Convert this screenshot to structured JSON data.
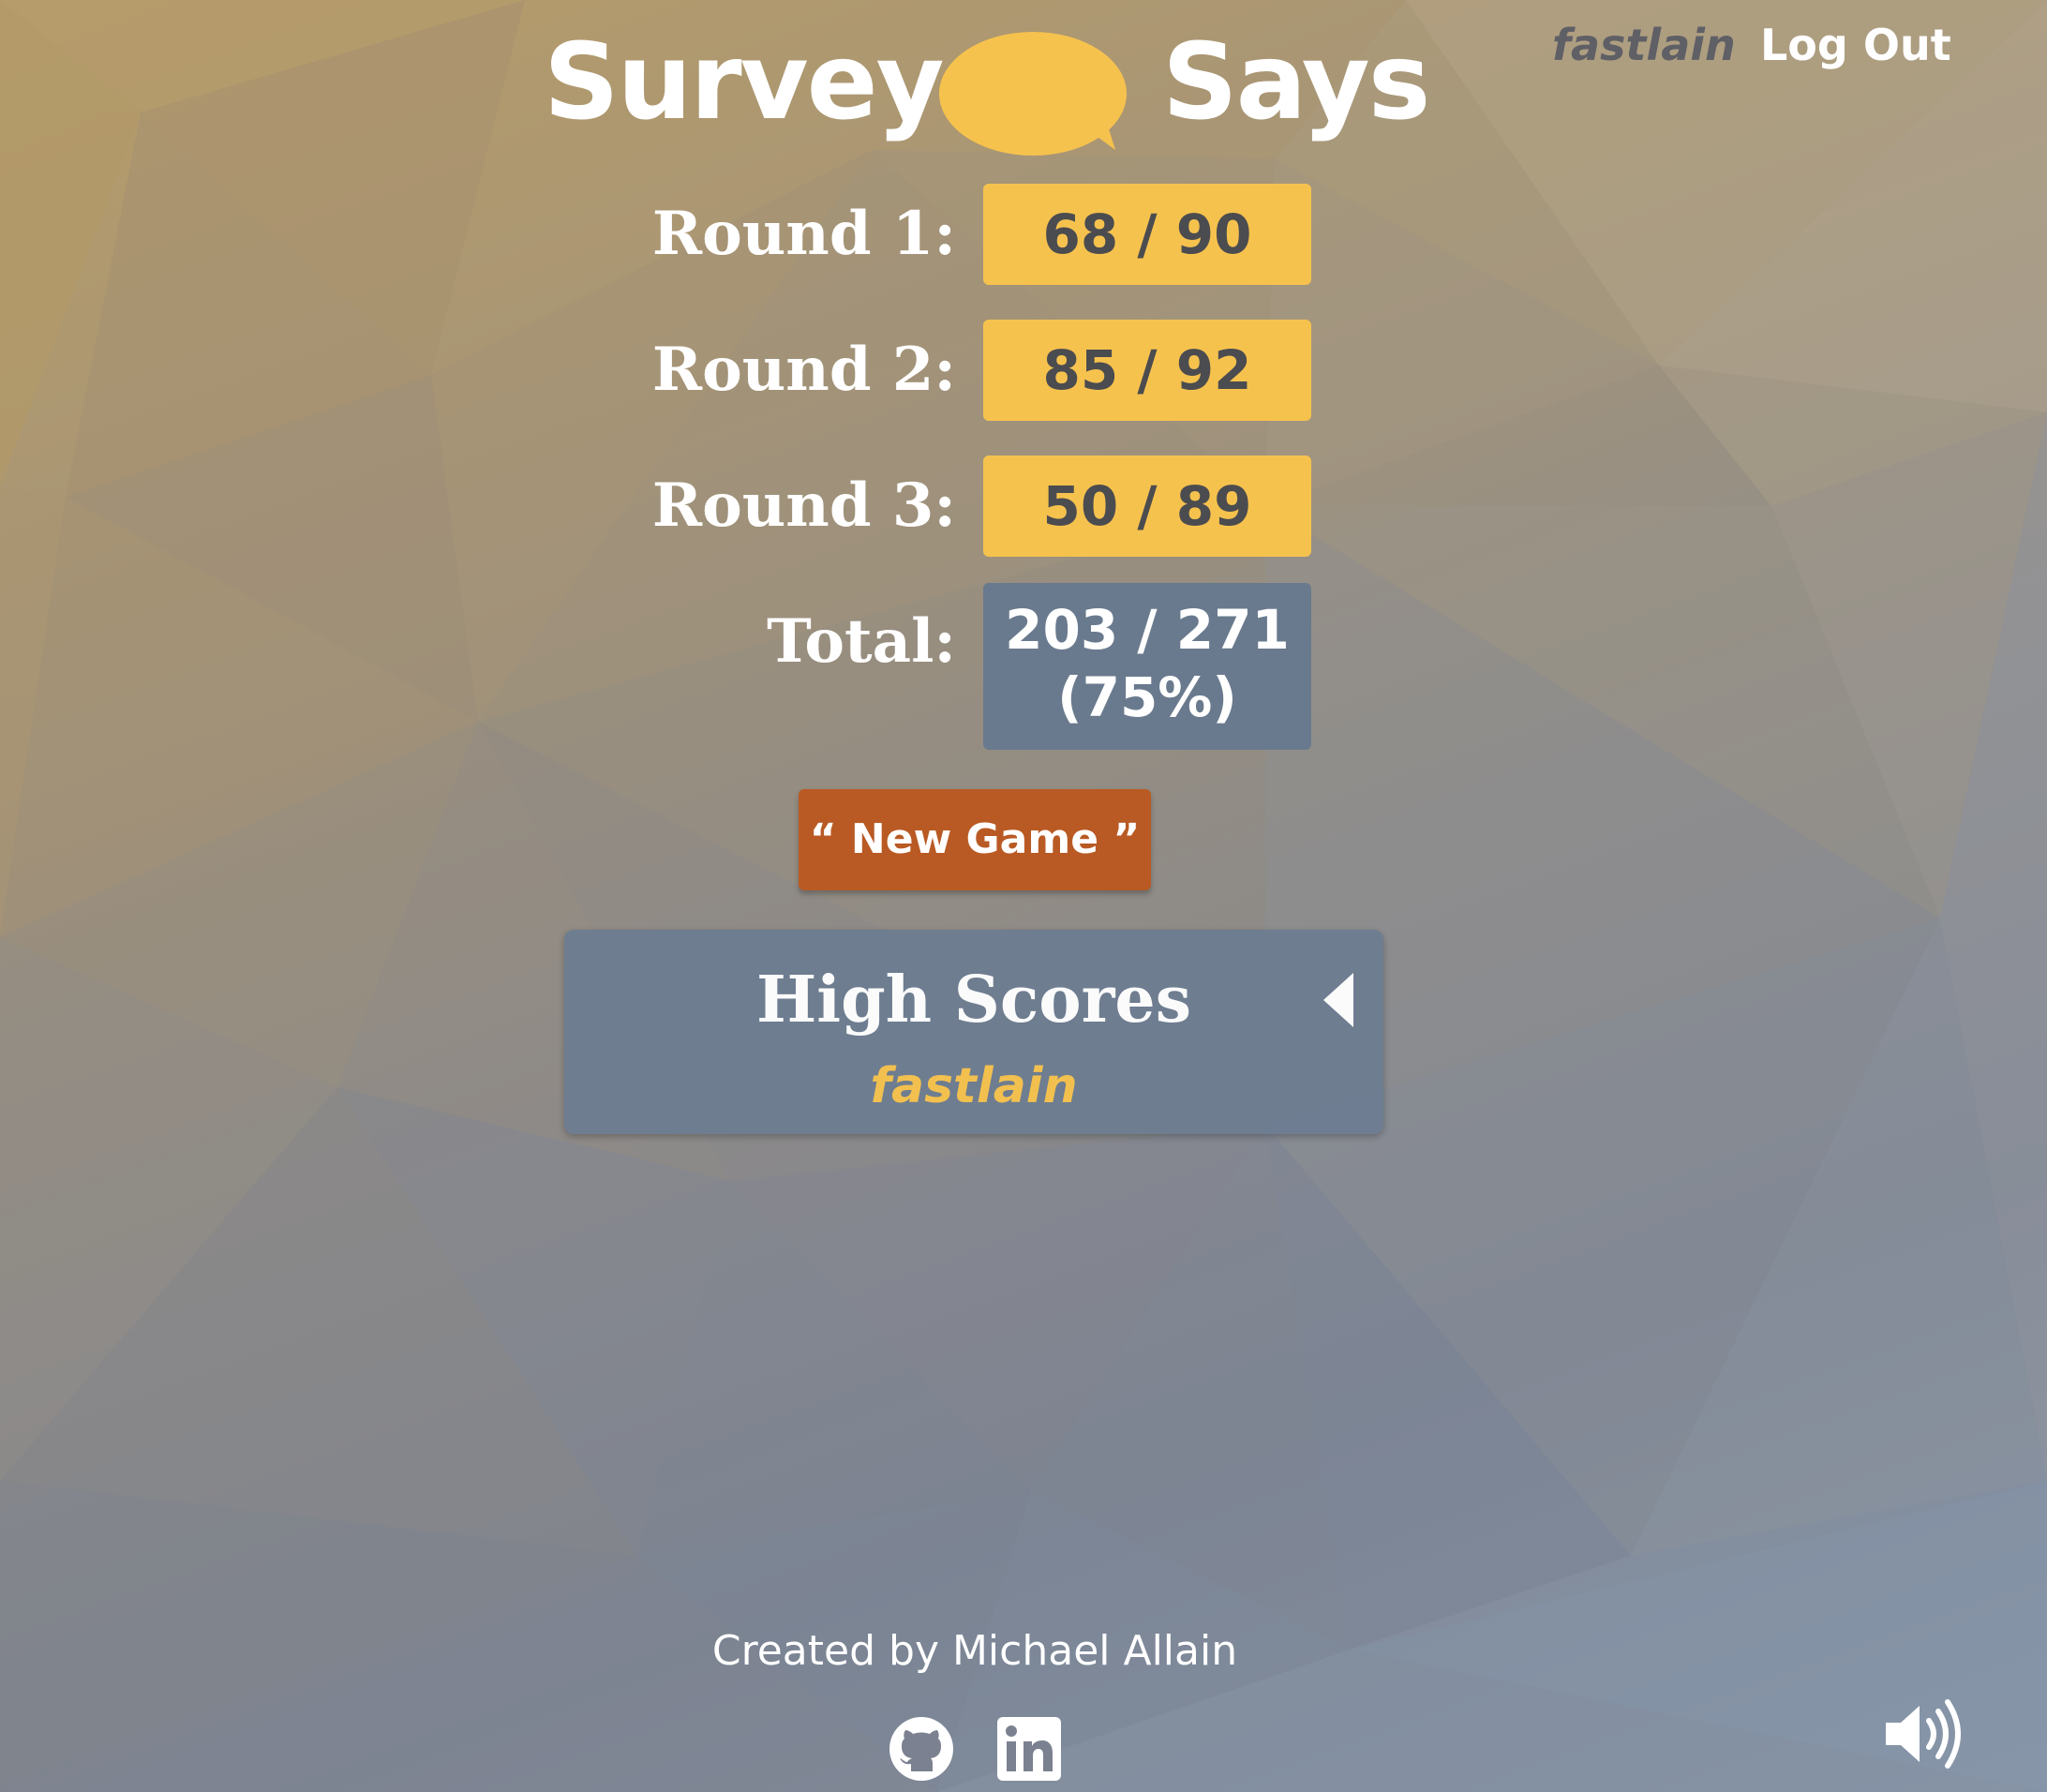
{
  "app": {
    "logo_left": "Survey",
    "logo_right": "Says"
  },
  "header": {
    "username": "fastlain",
    "logout_label": "Log Out"
  },
  "scores": {
    "rounds": [
      {
        "label": "Round 1:",
        "value": "68 / 90"
      },
      {
        "label": "Round 2:",
        "value": "85 / 92"
      },
      {
        "label": "Round 3:",
        "value": "50 / 89"
      }
    ],
    "total": {
      "label": "Total:",
      "value": "203 / 271",
      "percent": "(75%)"
    }
  },
  "actions": {
    "new_game_label": "“ New Game ”"
  },
  "high_scores": {
    "title": "High Scores",
    "highlighted_user": "fastlain",
    "toggle_icon": "caret-left-icon"
  },
  "footer": {
    "credit": "Created by Michael Allain",
    "icons": [
      "github-icon",
      "linkedin-icon",
      "volume-icon"
    ]
  },
  "colors": {
    "accent_yellow": "#f6c24e",
    "panel_slate": "#6a7a8e",
    "button_orange": "#b95a24",
    "text_dark": "#4b4c4f"
  }
}
